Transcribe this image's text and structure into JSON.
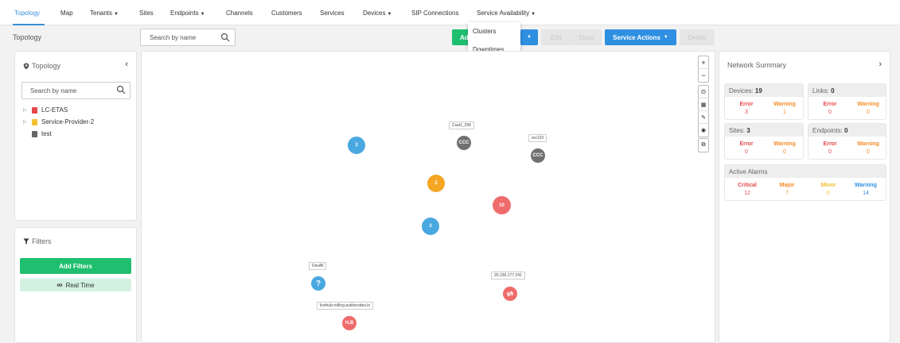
{
  "nav": {
    "items": [
      "Topology",
      "Map",
      "Tenants",
      "Sites",
      "Endpoints",
      "Channels",
      "Customers",
      "Services",
      "Devices",
      "SIP Connections",
      "Service Availability"
    ]
  },
  "header": {
    "title": "Topology",
    "search_placeholder": "Search by name",
    "add_label": "Ad",
    "edit_label": "Edit",
    "show_label": "Show",
    "service_actions_label": "Service Actions",
    "delete_label": "Delete"
  },
  "dropdown": {
    "items": [
      "Clusters",
      "Downtimes"
    ]
  },
  "left_panel": {
    "title": "Topology",
    "search_placeholder": "Search by name",
    "tree": [
      {
        "label": "LC-ETAS",
        "color": "#e5484d"
      },
      {
        "label": "Service-Provider-2",
        "color": "#f2c12e"
      },
      {
        "label": "test",
        "color": "#666666"
      }
    ]
  },
  "filters": {
    "title": "Filters",
    "add_label": "Add Filters",
    "realtime_label": "Real Time"
  },
  "canvas": {
    "nodes": [
      {
        "value": "3",
        "color": "#4aa8e0"
      },
      {
        "value": "2",
        "color": "#f5a623"
      },
      {
        "value": "10",
        "color": "#ef6b6b"
      },
      {
        "value": "2",
        "color": "#4aa8e0"
      }
    ],
    "labels": [
      "Cust1_DM",
      "srv123",
      "DevAll",
      "20.230.177.241",
      "livehub-rolling.audiocodes.io"
    ],
    "icon_texts": [
      "CCC",
      "CCC",
      "?",
      "H,B"
    ]
  },
  "summary": {
    "title": "Network Summary",
    "devices": {
      "label": "Devices:",
      "count": "19",
      "error": "3",
      "warning": "1"
    },
    "links": {
      "label": "Links:",
      "count": "0",
      "error": "0",
      "warning": "0"
    },
    "sites": {
      "label": "Sites:",
      "count": "3",
      "error": "0",
      "warning": "0"
    },
    "endpoints": {
      "label": "Endpoints:",
      "count": "0",
      "error": "0",
      "warning": "0"
    },
    "error_label": "Error",
    "warning_label": "Warning",
    "alarms": {
      "title": "Active Alarms",
      "critical_label": "Critical",
      "critical": "12",
      "major_label": "Major",
      "major": "7",
      "minor_label": "Minor",
      "minor": "0",
      "warning_label": "Warning",
      "warning": "14"
    }
  },
  "colors": {
    "accent": "#2f8fe0",
    "green": "#1fbf6f",
    "error": "#e5484d",
    "warning": "#f28c28",
    "minor": "#f2c12e"
  }
}
